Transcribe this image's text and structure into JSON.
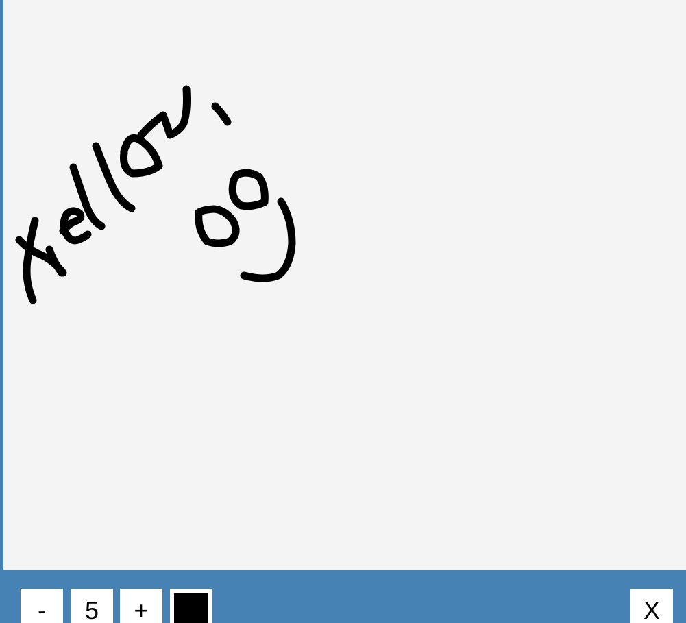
{
  "toolbar": {
    "decrease_label": "-",
    "brush_size": "5",
    "increase_label": "+",
    "close_label": "X"
  },
  "colors": {
    "canvas_background": "#f4f4f4",
    "toolbar_background": "#4682b4",
    "brush_color": "#000000"
  }
}
